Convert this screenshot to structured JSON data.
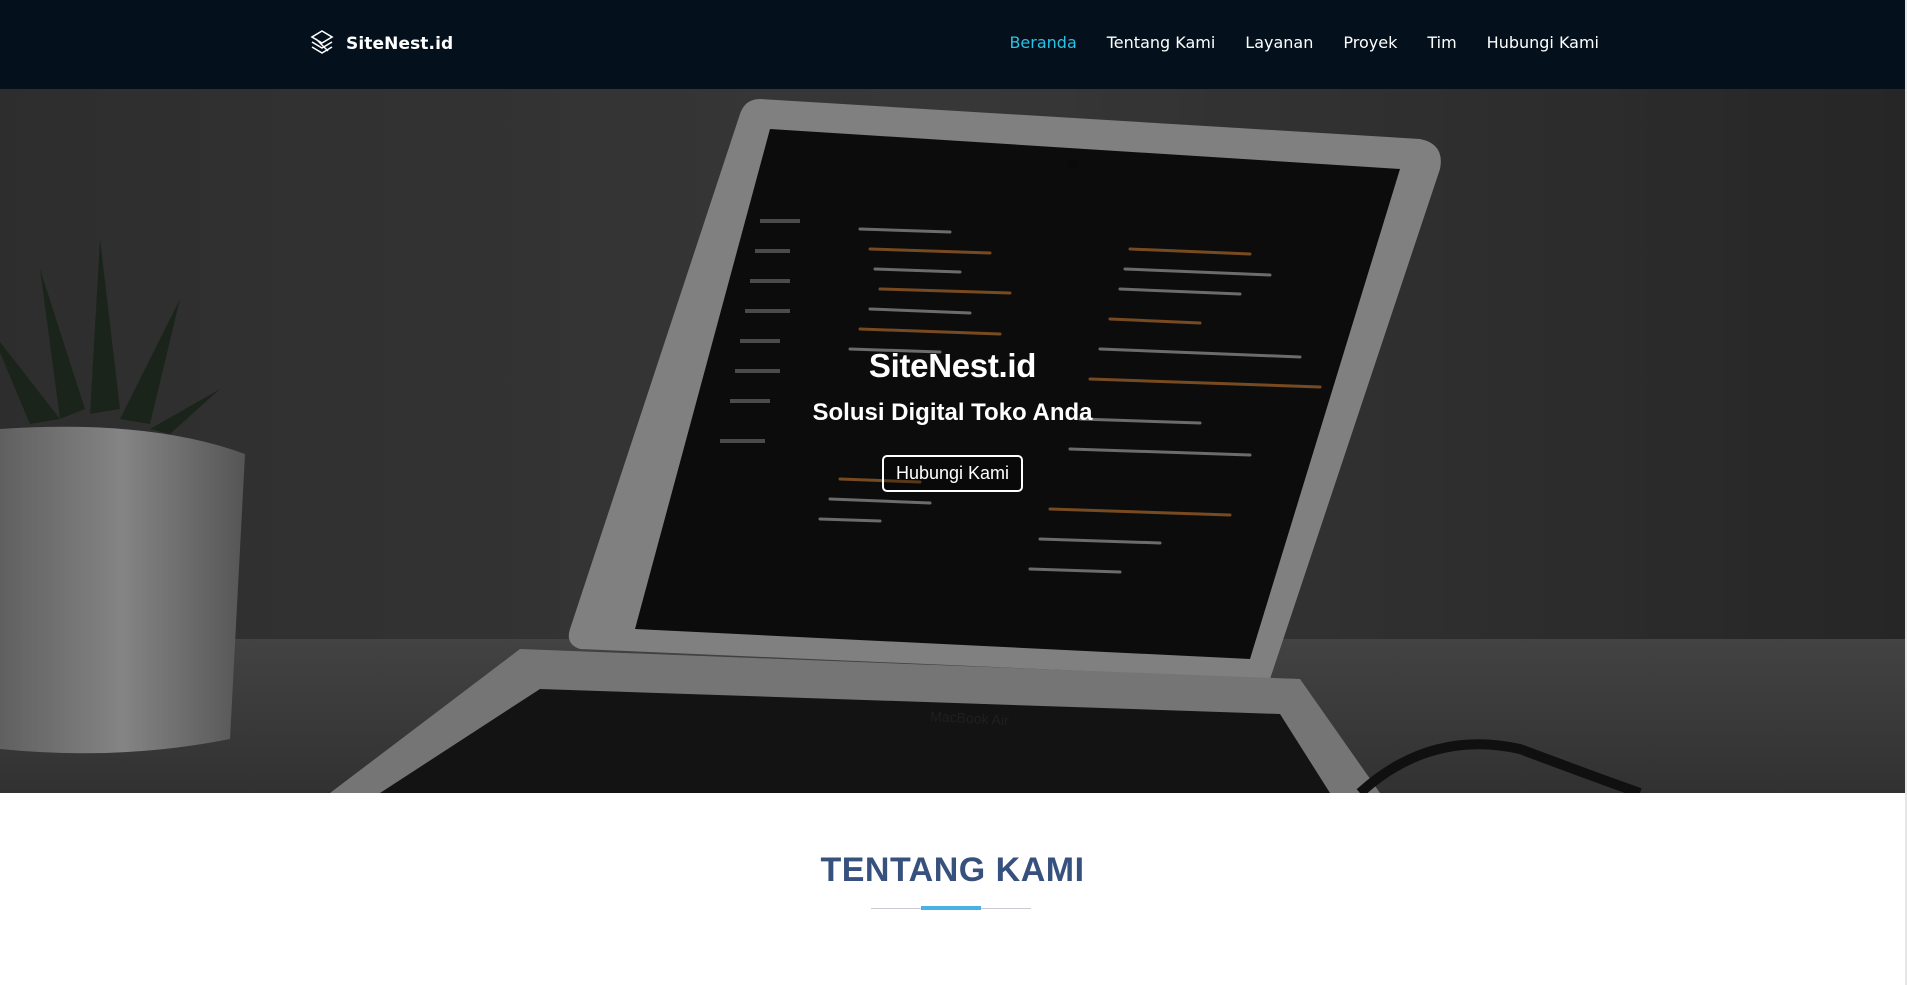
{
  "navbar": {
    "brand_name": "SiteNest.id",
    "brand_icon": "stacked-layers-logo-icon",
    "links": [
      {
        "label": "Beranda",
        "active": true
      },
      {
        "label": "Tentang Kami",
        "active": false
      },
      {
        "label": "Layanan",
        "active": false
      },
      {
        "label": "Proyek",
        "active": false
      },
      {
        "label": "Tim",
        "active": false
      },
      {
        "label": "Hubungi Kami",
        "active": false
      }
    ],
    "colors": {
      "background": "#04101c",
      "active": "#2cc1e6",
      "text": "#ffffff"
    }
  },
  "hero": {
    "title": "SiteNest.id",
    "subtitle": "Solusi Digital Toko Anda",
    "button_label": "Hubungi Kami",
    "laptop_label": "MacBook Air"
  },
  "about": {
    "title": "TENTANG KAMI",
    "colors": {
      "title": "#37517e",
      "accent": "#47b2e4"
    }
  }
}
